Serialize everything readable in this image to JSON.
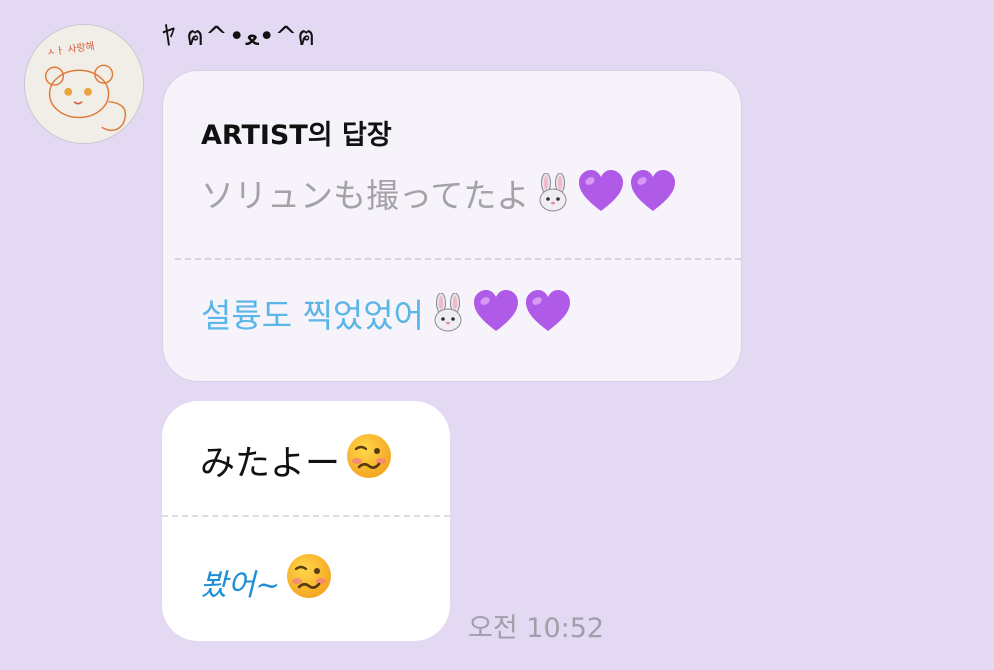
{
  "sender": {
    "name": "ﾔ ฅ^•ﻌ•^ฅ"
  },
  "reply": {
    "title": "ARTIST의 답장",
    "original_text": "ソリュンも撮ってたよ",
    "translated_text": "설륭도 찍었었어",
    "emojis": [
      "rabbit-face-icon",
      "purple-heart-icon",
      "purple-heart-icon"
    ]
  },
  "message": {
    "text": "みたよー",
    "translated_text": "봤어~",
    "emoji": "woozy-face-icon"
  },
  "timestamp": "오전 10:52",
  "colors": {
    "background": "#e4d9f2",
    "reply_bubble": "#f6f3fa",
    "message_bubble": "#ffffff",
    "translation_text": "#59b6e6",
    "original_text": "#a4a1a8"
  }
}
